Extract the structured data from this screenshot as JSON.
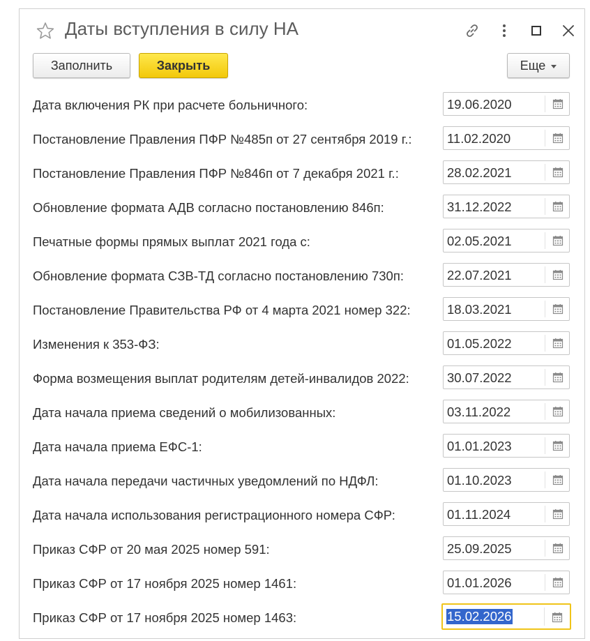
{
  "window": {
    "title": "Даты вступления в силу НА"
  },
  "toolbar": {
    "fill_label": "Заполнить",
    "close_label": "Закрыть",
    "more_label": "Еще"
  },
  "icons": {
    "favorite": "star-icon",
    "link": "link-icon",
    "menu": "more-vertical-icon",
    "maximize": "maximize-icon",
    "close": "close-icon",
    "calendar": "calendar-icon"
  },
  "colors": {
    "primary_button": "#f5d31c",
    "active_field_border": "#f0c419",
    "selection": "#3366cc",
    "text": "#333333",
    "title": "#5c5c5c"
  },
  "rows": [
    {
      "label": "Дата включения РК при расчете больничного:",
      "value": "19.06.2020"
    },
    {
      "label": "Постановление Правления ПФР №485п от 27 сентября 2019 г.:",
      "value": "11.02.2020"
    },
    {
      "label": "Постановление Правления ПФР №846п от 7 декабря 2021 г.:",
      "value": "28.02.2021"
    },
    {
      "label": "Обновление формата АДВ согласно постановлению 846п:",
      "value": "31.12.2022"
    },
    {
      "label": "Печатные формы прямых выплат 2021 года с:",
      "value": "02.05.2021"
    },
    {
      "label": "Обновление формата СЗВ-ТД согласно постановлению 730п:",
      "value": "22.07.2021"
    },
    {
      "label": "Постановление Правительства РФ от 4 марта 2021 номер 322:",
      "value": "18.03.2021"
    },
    {
      "label": "Изменения к 353-ФЗ:",
      "value": "01.05.2022"
    },
    {
      "label": "Форма возмещения выплат родителям детей-инвалидов 2022:",
      "value": "30.07.2022"
    },
    {
      "label": "Дата начала приема сведений о мобилизованных:",
      "value": "03.11.2022"
    },
    {
      "label": "Дата начала приема ЕФС-1:",
      "value": "01.01.2023"
    },
    {
      "label": "Дата начала передачи частичных уведомлений по НДФЛ:",
      "value": "01.10.2023"
    },
    {
      "label": "Дата начала использования регистрационного номера СФР:",
      "value": "01.11.2024"
    },
    {
      "label": "Приказ СФР от 20 мая 2025 номер 591:",
      "value": "25.09.2025"
    },
    {
      "label": "Приказ СФР от 17 ноября 2025 номер 1461:",
      "value": "01.01.2026"
    },
    {
      "label": "Приказ СФР от 17 ноября 2025 номер 1463:",
      "value": "15.02.2026",
      "active": true
    }
  ]
}
